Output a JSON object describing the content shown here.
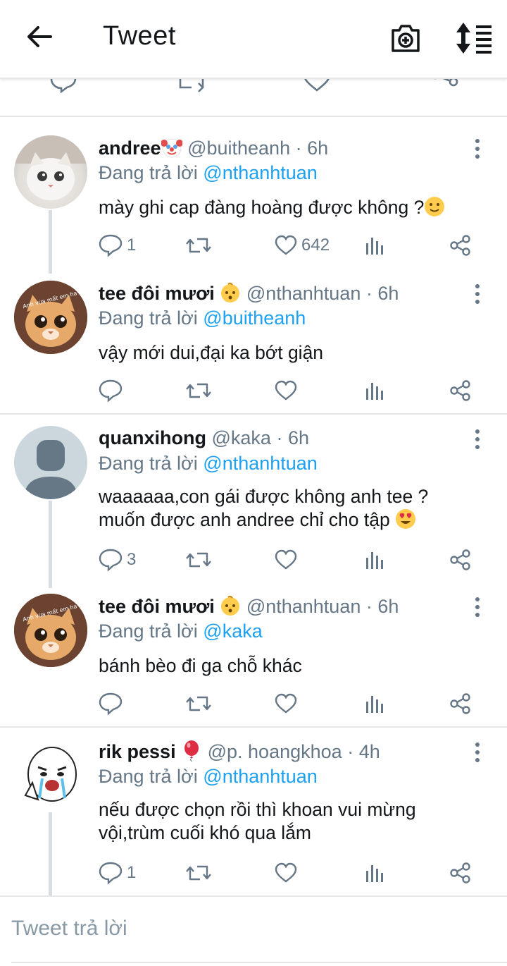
{
  "topbar": {
    "title": "Tweet"
  },
  "tweets": [
    {
      "name": "andree",
      "handle": "@buitheanh",
      "time": "6h",
      "reply_prefix": "Đang trả lời",
      "reply_to": "@nthanhtuan",
      "body": [
        "mày ghi cap đàng hoàng được không ?"
      ],
      "replies": "1",
      "likes": "642",
      "name_emoji": "clown-face",
      "body_emoji": "slightly-smiling-face"
    },
    {
      "name": "tee đôi mươi",
      "handle": "@nthanhtuan",
      "time": "6h",
      "reply_prefix": "Đang trả lời",
      "reply_to": "@buitheanh",
      "body": [
        "vậy mới dui,đại ka bớt giận"
      ],
      "replies": "",
      "likes": "",
      "name_emoji": "baby-face"
    },
    {
      "name": "quanxihong",
      "handle": "@kaka",
      "time": "6h",
      "reply_prefix": "Đang trả lời",
      "reply_to": "@nthanhtuan",
      "body": [
        "waaaaaa,con gái được không anh tee ?",
        "muốn được anh andree chỉ cho tập"
      ],
      "replies": "3",
      "likes": "",
      "body_emoji": "heart-eyes"
    },
    {
      "name": "tee đôi mươi",
      "handle": "@nthanhtuan",
      "time": "6h",
      "reply_prefix": "Đang trả lời",
      "reply_to": "@kaka",
      "body": [
        "bánh bèo đi ga chỗ khác"
      ],
      "replies": "",
      "likes": "",
      "name_emoji": "baby-face"
    },
    {
      "name": "rik pessi",
      "handle": "@p. hoangkhoa",
      "time": "4h",
      "reply_prefix": "Đang trả lời",
      "reply_to": "@nthanhtuan",
      "body": [
        "nếu được chọn rồi thì khoan vui mừng",
        "vội,trùm cuối khó qua lắm"
      ],
      "replies": "1",
      "likes": "",
      "name_emoji": "balloon"
    }
  ],
  "avatar_text": {
    "tee": "Anh vừa mất em ha"
  },
  "compose": {
    "placeholder": "Tweet trả lời"
  },
  "colors": {
    "accent": "#1da1f2",
    "secondary_text": "#657786",
    "divider": "#e6e6e6"
  }
}
